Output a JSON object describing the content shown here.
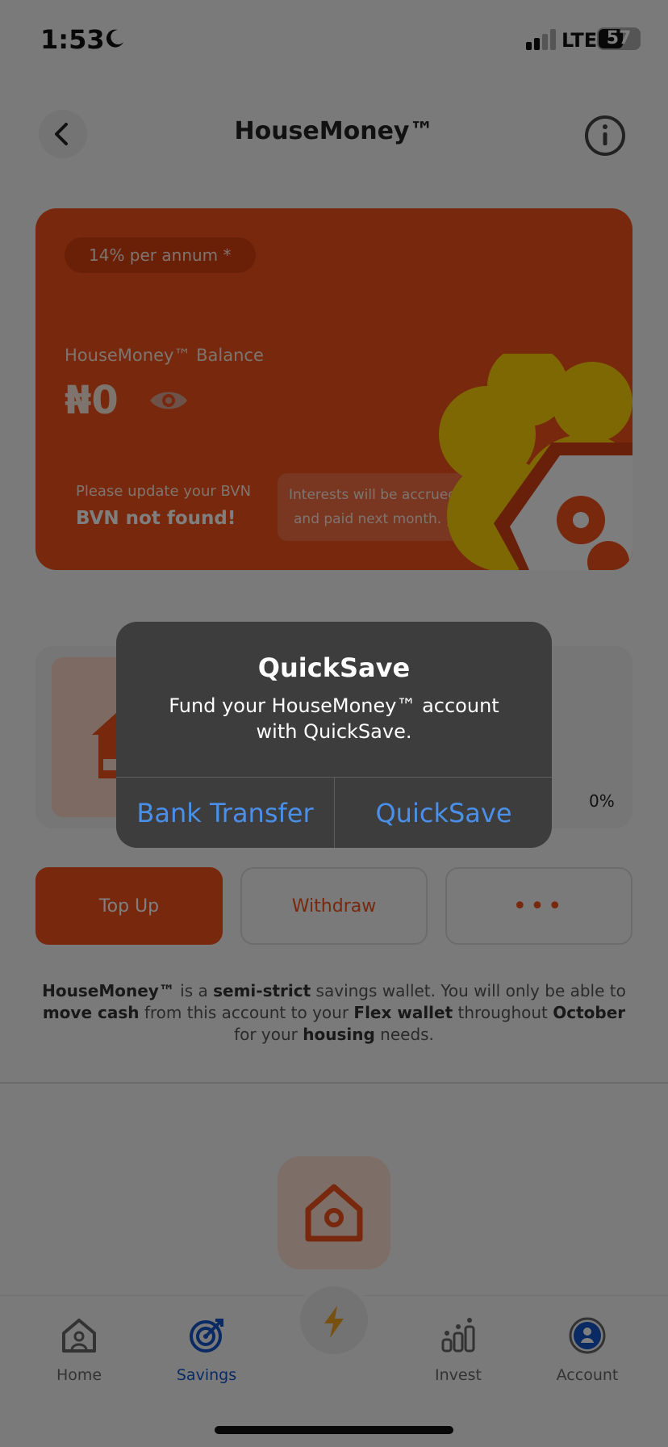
{
  "status": {
    "time": "1:53",
    "network": "LTE",
    "battery": "57"
  },
  "header": {
    "title": "HouseMoney™"
  },
  "card": {
    "rate": "14% per annum *",
    "balance_label": "HouseMoney™ Balance",
    "balance_value": "₦0",
    "bvn_sub": "Please update your BVN",
    "bvn_main": "BVN not found!",
    "interest_line1": "Interests will be accrued daily",
    "interest_line2": "and paid next month. 🎉"
  },
  "goal": {
    "percent": "0%",
    "progress": 0
  },
  "actions": {
    "topup": "Top Up",
    "withdraw": "Withdraw",
    "more": "•••"
  },
  "description": {
    "p1": "HouseMoney™",
    "p2": " is a ",
    "p3": "semi-strict",
    "p4": " savings wallet. You will only be able to ",
    "p5": "move cash",
    "p6": " from this account to your ",
    "p7": "Flex wallet",
    "p8": " throughout ",
    "p9": "October",
    "p10": " for your ",
    "p11": "housing",
    "p12": " needs."
  },
  "tabs": {
    "home": "Home",
    "savings": "Savings",
    "invest": "Invest",
    "account": "Account"
  },
  "dialog": {
    "title": "QuickSave",
    "message": "Fund your HouseMoney™ account with QuickSave.",
    "button_left": "Bank Transfer",
    "button_right": "QuickSave"
  },
  "colors": {
    "brand": "#f0501a",
    "savings_active": "#1455c8",
    "dialog_link": "#4a8fe8"
  }
}
